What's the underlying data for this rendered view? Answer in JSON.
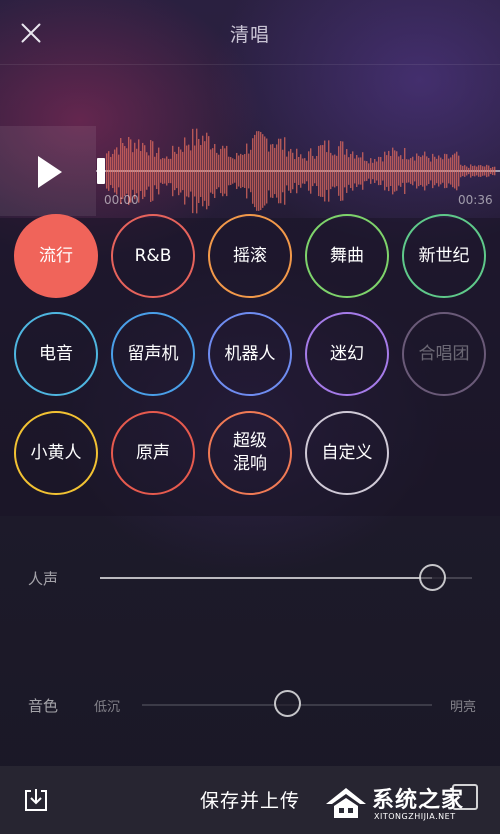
{
  "header": {
    "title": "清唱",
    "close_icon": "close-icon"
  },
  "player": {
    "play_icon": "play-icon",
    "time_start": "00:00",
    "time_end": "00:36",
    "progress": 0.0,
    "waveform_color": "#e06a5e"
  },
  "effects": [
    {
      "label": "流行",
      "color": "#f0645a",
      "active": true,
      "enabled": true
    },
    {
      "label": "R&B",
      "color": "#e6635c",
      "active": false,
      "enabled": true
    },
    {
      "label": "摇滚",
      "color": "#f2994a",
      "active": false,
      "enabled": true
    },
    {
      "label": "舞曲",
      "color": "#7ed36b",
      "active": false,
      "enabled": true
    },
    {
      "label": "新世纪",
      "color": "#5fc98a",
      "active": false,
      "enabled": true
    },
    {
      "label": "电音",
      "color": "#4fb6e0",
      "active": false,
      "enabled": true
    },
    {
      "label": "留声机",
      "color": "#4a9fe8",
      "active": false,
      "enabled": true
    },
    {
      "label": "机器人",
      "color": "#6f8cf0",
      "active": false,
      "enabled": true
    },
    {
      "label": "迷幻",
      "color": "#a57be8",
      "active": false,
      "enabled": true
    },
    {
      "label": "合唱团",
      "color": "#6a5a78",
      "active": false,
      "enabled": false
    },
    {
      "label": "小黄人",
      "color": "#f2c233",
      "active": false,
      "enabled": true
    },
    {
      "label": "原声",
      "color": "#e65a4e",
      "active": false,
      "enabled": true
    },
    {
      "label": "超级\n混响",
      "color": "#f07a55",
      "active": false,
      "enabled": true
    },
    {
      "label": "自定义",
      "color": "#cfc9d6",
      "active": false,
      "enabled": true
    }
  ],
  "vocal_slider": {
    "label": "人声",
    "value": 0.9
  },
  "timbre_slider": {
    "label": "音色",
    "min_label": "低沉",
    "max_label": "明亮",
    "value": 0.5
  },
  "bottom_bar": {
    "save_label": "保存并上传",
    "download_icon": "download-icon",
    "share_icon": "share-icon"
  },
  "watermark": {
    "text": "系统之家",
    "subtext": "XITONGZHIJIA.NET"
  }
}
